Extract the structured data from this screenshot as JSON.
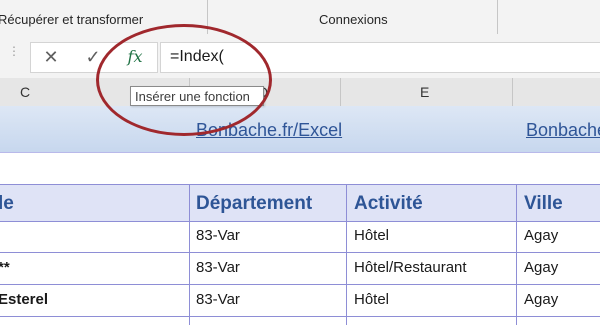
{
  "ribbon": {
    "groups": [
      "Récupérer et transformer",
      "Connexions"
    ]
  },
  "formula_bar": {
    "grip": "⋮",
    "cancel_icon": "✕",
    "enter_icon": "✓",
    "fx_label": "fx",
    "formula": "=Index("
  },
  "tooltip": "Insérer une fonction",
  "columns": {
    "c": "C",
    "d": "D",
    "e": "E"
  },
  "banner": {
    "link1": "Bonbache.fr/Excel",
    "link2": "Bonbache"
  },
  "table": {
    "headers": [
      "le",
      "Département",
      "Activité",
      "Ville"
    ],
    "rows": [
      [
        "",
        "83-Var",
        "Hôtel",
        "Agay"
      ],
      [
        "**",
        "83-Var",
        "Hôtel/Restaurant",
        "Agay"
      ],
      [
        "Esterel",
        "83-Var",
        "Hôtel",
        "Agay"
      ]
    ]
  },
  "colors": {
    "accent": "#2e5596",
    "callout": "#a0282d",
    "fx_green": "#217346"
  }
}
